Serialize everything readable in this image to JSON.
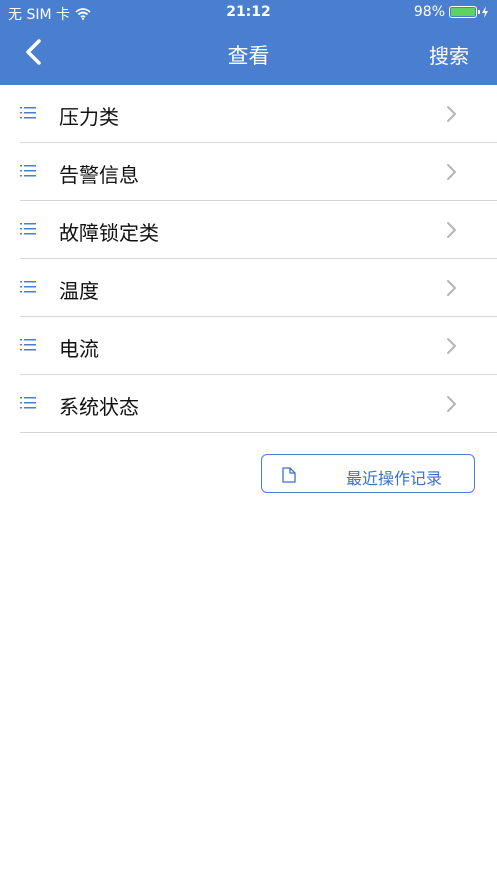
{
  "status_bar": {
    "carrier": "无 SIM 卡",
    "time": "21:12",
    "battery_percent": "98%",
    "battery_level": 0.98
  },
  "nav": {
    "title": "查看",
    "search_label": "搜索",
    "back_icon": "chevron-left-icon"
  },
  "menu": {
    "items": [
      {
        "label": "压力类"
      },
      {
        "label": "告警信息"
      },
      {
        "label": "故障锁定类"
      },
      {
        "label": "温度"
      },
      {
        "label": "电流"
      },
      {
        "label": "系统状态"
      }
    ]
  },
  "recent": {
    "label": "最近操作记录",
    "icon": "document-icon"
  },
  "colors": {
    "accent": "#4a7fcf",
    "battery": "#5fd35f",
    "divider": "#d6d6d6"
  }
}
